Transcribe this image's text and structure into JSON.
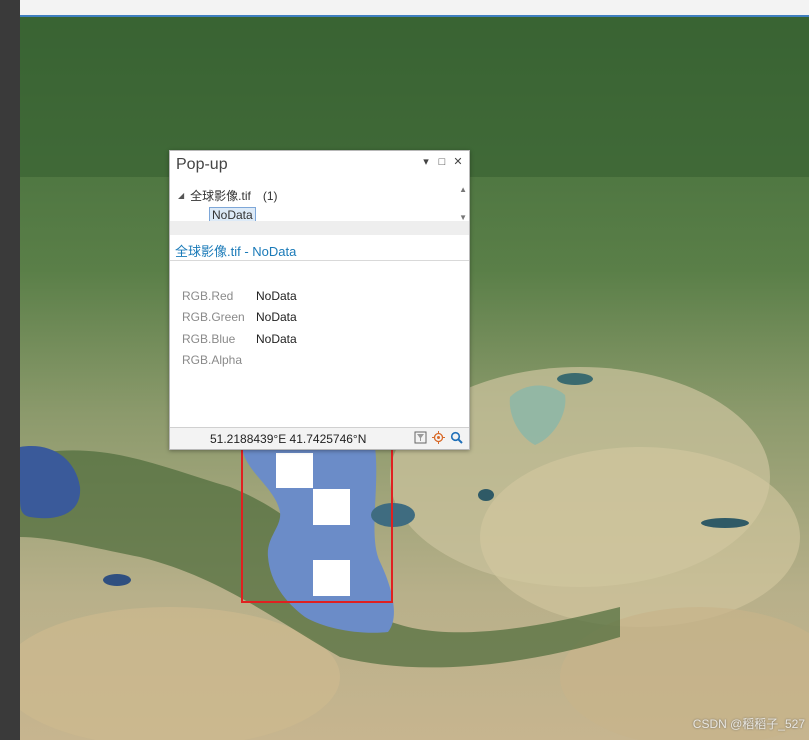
{
  "popup": {
    "title": "Pop-up",
    "controls": {
      "menu": "▾",
      "restore": "□",
      "close": "✕"
    },
    "tree": {
      "layer_name": "全球影像.tif",
      "count": "(1)",
      "selected_item": "NoData"
    },
    "feature_title": "全球影像.tif - NoData",
    "fields": [
      {
        "name": "RGB.Red",
        "value": "NoData"
      },
      {
        "name": "RGB.Green",
        "value": "NoData"
      },
      {
        "name": "RGB.Blue",
        "value": "NoData"
      },
      {
        "name": "RGB.Alpha",
        "value": ""
      }
    ],
    "coordinates": "51.2188439°E 41.7425746°N",
    "footer_icons": [
      "filter-icon",
      "locate-icon",
      "search-icon"
    ]
  },
  "watermark": "CSDN @稻稻子_527",
  "colors": {
    "highlight_box": "#e02020",
    "caspian": "#6b8cc8",
    "nodata_block": "#ffffff"
  }
}
